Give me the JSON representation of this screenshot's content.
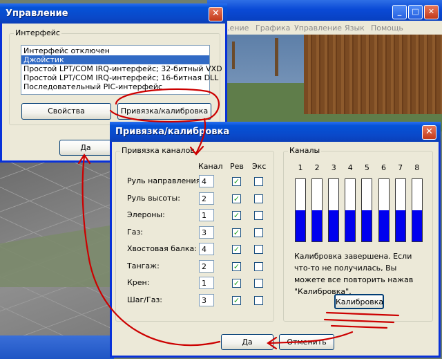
{
  "background_app": {
    "menu": [
      "...ение",
      "Графика",
      "Управление",
      "Язык",
      "Помощь"
    ]
  },
  "control_dialog": {
    "title": "Управление",
    "interface_group_label": "Интерфейс",
    "interfaces": [
      {
        "label": "Интерфейс отключен",
        "selected": false
      },
      {
        "label": "Джойстик",
        "selected": true
      },
      {
        "label": "Простой LPT/COM IRQ-интерфейс; 32-битный VXD",
        "selected": false
      },
      {
        "label": "Простой LPT/COM IRQ-интерфейс; 16-битная DLL",
        "selected": false
      },
      {
        "label": "Последовательный PIC-интерфейс",
        "selected": false
      }
    ],
    "properties_button": "Свойства",
    "binding_button": "Привязка/калибровка",
    "ok_button": "Да"
  },
  "binding_dialog": {
    "title": "Привязка/калибровка",
    "channels_binding_group": "Привязка каналов",
    "col_channel": "Канал",
    "col_rev": "Рев",
    "col_exp": "Экс",
    "rows": [
      {
        "label": "Руль направления:",
        "channel": "4",
        "rev": true,
        "exp": false
      },
      {
        "label": "Руль высоты:",
        "channel": "2",
        "rev": true,
        "exp": false
      },
      {
        "label": "Элероны:",
        "channel": "1",
        "rev": true,
        "exp": false
      },
      {
        "label": "Газ:",
        "channel": "3",
        "rev": true,
        "exp": false
      },
      {
        "label": "Хвостовая балка:",
        "channel": "4",
        "rev": true,
        "exp": false
      },
      {
        "label": "Тангаж:",
        "channel": "2",
        "rev": true,
        "exp": false
      },
      {
        "label": "Крен:",
        "channel": "1",
        "rev": true,
        "exp": false
      },
      {
        "label": "Шаг/Газ:",
        "channel": "3",
        "rev": true,
        "exp": false
      }
    ],
    "channels_group": "Каналы",
    "channels": [
      {
        "number": "1",
        "level": 0.5
      },
      {
        "number": "2",
        "level": 0.5
      },
      {
        "number": "3",
        "level": 0.5
      },
      {
        "number": "4",
        "level": 0.5
      },
      {
        "number": "5",
        "level": 0.5
      },
      {
        "number": "6",
        "level": 0.5
      },
      {
        "number": "7",
        "level": 0.5
      },
      {
        "number": "8",
        "level": 0.5
      }
    ],
    "calibration_message": "Калибровка завершена. Если что-то не получилась, Вы можете все повторить нажав \"Калибровка\".",
    "calibrate_button": "Калибровка",
    "ok_button": "Да",
    "cancel_button": "Отменить"
  },
  "colors": {
    "annotation": "#cc0000",
    "channel_fill": "#0000ee",
    "titlebar": "#0a48c8"
  }
}
